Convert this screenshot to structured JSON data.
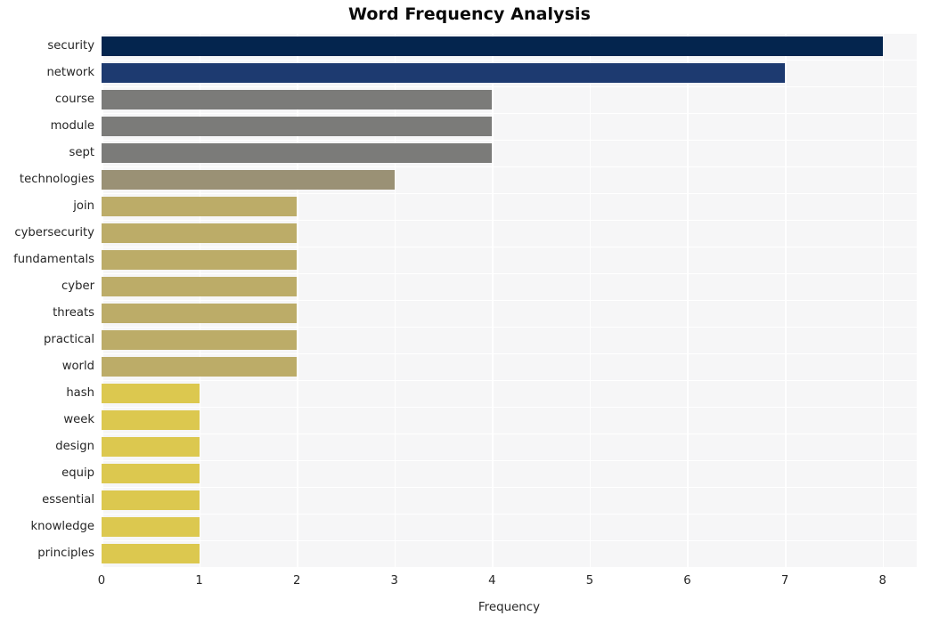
{
  "chart_data": {
    "type": "bar",
    "orientation": "horizontal",
    "title": "Word Frequency Analysis",
    "xlabel": "Frequency",
    "ylabel": "",
    "xlim": [
      0,
      8.35
    ],
    "ylim": [
      0,
      20
    ],
    "xticks": [
      "0",
      "1",
      "2",
      "3",
      "4",
      "5",
      "6",
      "7",
      "8"
    ],
    "xtick_values": [
      0,
      1,
      2,
      3,
      4,
      5,
      6,
      7,
      8
    ],
    "grid": true,
    "grid_color": "#ffffff",
    "plot_background": "#f6f6f7",
    "figure_background": "#ffffff",
    "legend": null,
    "categories": [
      "security",
      "network",
      "course",
      "module",
      "sept",
      "technologies",
      "join",
      "cybersecurity",
      "fundamentals",
      "cyber",
      "threats",
      "practical",
      "world",
      "hash",
      "week",
      "design",
      "equip",
      "essential",
      "knowledge",
      "principles"
    ],
    "values": [
      8,
      7,
      4,
      4,
      4,
      3,
      2,
      2,
      2,
      2,
      2,
      2,
      2,
      1,
      1,
      1,
      1,
      1,
      1,
      1
    ],
    "bar_colors": [
      "#04254e",
      "#1d3a70",
      "#7b7b79",
      "#7b7b79",
      "#7b7b79",
      "#9a9175",
      "#bcac68",
      "#bcac68",
      "#bcac68",
      "#bcac68",
      "#bcac68",
      "#bcac68",
      "#bcac68",
      "#dcc84f",
      "#dcc84f",
      "#dcc84f",
      "#dcc84f",
      "#dcc84f",
      "#dcc84f",
      "#dcc84f"
    ]
  }
}
